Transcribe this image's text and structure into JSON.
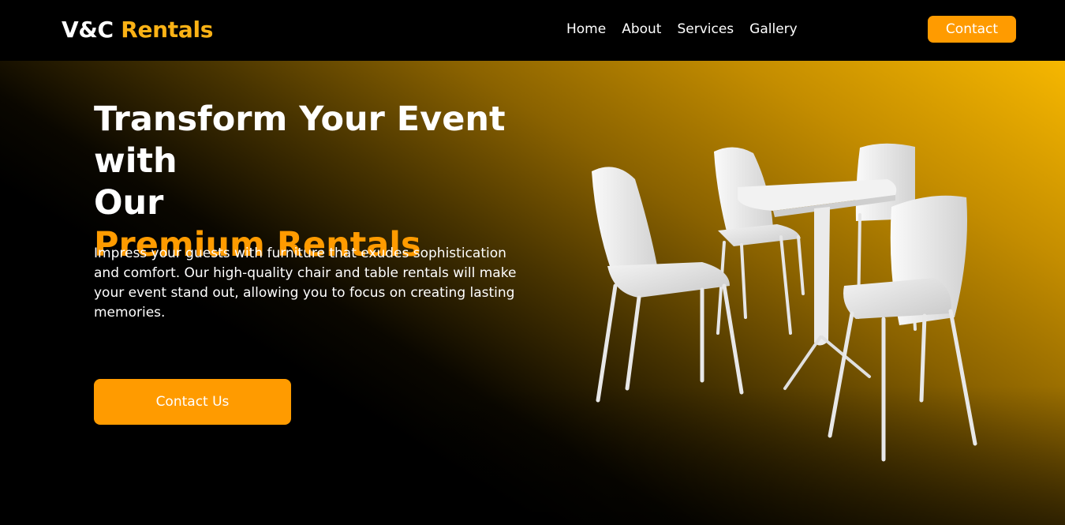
{
  "brand": {
    "part1": "V&C",
    "part2": "Rentals"
  },
  "nav": {
    "items": [
      {
        "label": "Home"
      },
      {
        "label": "About"
      },
      {
        "label": "Services"
      },
      {
        "label": "Gallery"
      }
    ],
    "contact_label": "Contact"
  },
  "hero": {
    "headline_line1": "Transform Your Event with",
    "headline_line2": "Our",
    "headline_accent": "Premium Rentals",
    "description": "Impress your guests with furniture that exudes sophistication and comfort. Our high-quality chair and table rentals will make your event stand out, allowing you to focus on creating lasting memories.",
    "cta_label": "Contact Us"
  },
  "colors": {
    "accent": "#ff9b00",
    "brand_yellow": "#fbb215",
    "background": "#000000",
    "gradient_gold": "#f6b700"
  },
  "icons": {
    "hero_image": "chairs-and-table-illustration"
  }
}
